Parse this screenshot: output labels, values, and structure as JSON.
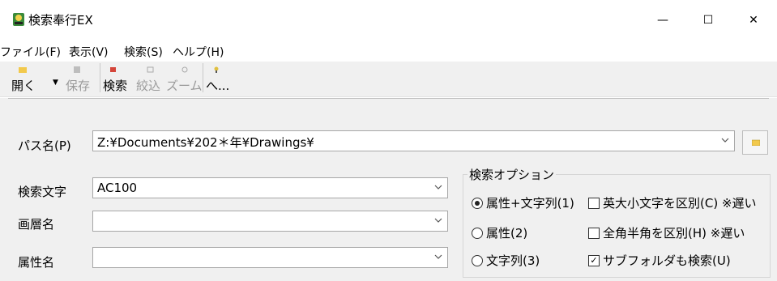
{
  "window": {
    "title": "検索奉行EX",
    "minimize_glyph": "—",
    "maximize_glyph": "☐",
    "close_glyph": "✕"
  },
  "menu": [
    {
      "label": "ファイル(F)"
    },
    {
      "label": "表示(V)"
    },
    {
      "label": "検索(S)"
    },
    {
      "label": "ヘルプ(H)"
    }
  ],
  "toolbar": {
    "open": {
      "label": "開く",
      "icon": "folder-open-icon",
      "enabled": true
    },
    "open_dropdown": {
      "glyph": "▼"
    },
    "save": {
      "label": "保存",
      "icon": "save-icon",
      "enabled": false
    },
    "search": {
      "label": "検索",
      "icon": "search-icon",
      "enabled": true
    },
    "filter": {
      "label": "絞込",
      "icon": "filter-icon",
      "enabled": false
    },
    "zoom": {
      "label": "ズーム",
      "icon": "zoom-icon",
      "enabled": false
    },
    "help": {
      "label": "へ...",
      "icon": "help-icon",
      "enabled": true
    }
  },
  "form": {
    "path": {
      "label": "パス名(P)",
      "value": "Z:¥Documents¥202＊年¥Drawings¥"
    },
    "search_text": {
      "label": "検索文字",
      "value": "AC100"
    },
    "layer_name": {
      "label": "画層名",
      "value": ""
    },
    "attribute_name": {
      "label": "属性名",
      "value": ""
    }
  },
  "options": {
    "title": "検索オプション",
    "radios": [
      {
        "label": "属性+文字列(1)",
        "selected": true
      },
      {
        "label": "属性(2)",
        "selected": false
      },
      {
        "label": "文字列(3)",
        "selected": false
      }
    ],
    "checks": [
      {
        "label": "英大小文字を区別(C) ※遅い",
        "checked": false
      },
      {
        "label": "全角半角を区別(H) ※遅い",
        "checked": false
      },
      {
        "label": "サブフォルダも検索(U)",
        "checked": true
      }
    ]
  },
  "colors": {
    "panel_bg": "#f0f0f0",
    "disabled_text": "#9a9a9a",
    "folder_icon": "#f2c94c"
  }
}
